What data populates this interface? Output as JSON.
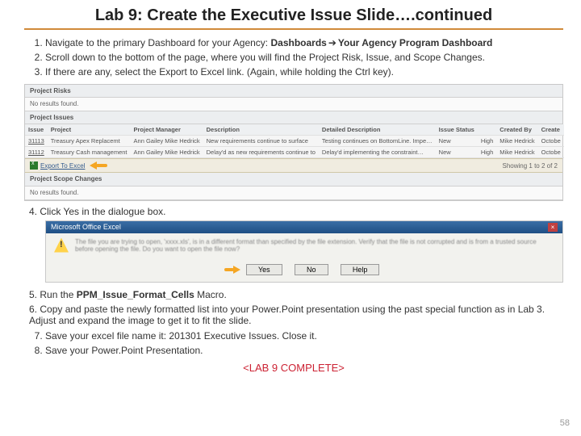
{
  "title": "Lab 9: Create the Executive Issue Slide….continued",
  "steps_top": [
    {
      "pre": "Navigate to the primary Dashboard for your Agency: ",
      "bold": "Dashboards",
      "arrow": "➔",
      "bold2": "Your Agency Program Dashboard"
    },
    {
      "text": "Scroll down to the bottom of the page, where you will find the Project Risk, Issue, and Scope Changes."
    },
    {
      "text": "If there are any, select the Export to Excel link. (Again, while holding the Ctrl key)."
    }
  ],
  "dashboard": {
    "sections": {
      "risks_title": "Project Risks",
      "risks_empty": "No results found.",
      "issues_title": "Project Issues",
      "scope_title": "Project Scope Changes",
      "scope_empty": "No results found."
    },
    "issue_columns": [
      "Issue",
      "Project",
      "Project Manager",
      "Description",
      "Detailed Description",
      "Issue Status",
      "",
      "Created By",
      "Create"
    ],
    "issue_rows": [
      {
        "c": [
          "31113",
          "Treasury Apex Replacemt",
          "Ann Gailey Mike Hedrick",
          "New requirements continue to surface",
          "Testing continues on BottomLine. Impe…",
          "New",
          "High",
          "Mike Hedrick",
          "Octobe"
        ]
      },
      {
        "c": [
          "31112",
          "Treasury Cash management",
          "Ann Gailey Mike Hedrick",
          "Delay'd as new requirements continue to",
          "Delay'd implementing the constraint…",
          "New",
          "High",
          "Mike Hedrick",
          "Octobe"
        ]
      }
    ],
    "export_label": "Export To Excel",
    "showing": "Showing 1 to 2 of 2"
  },
  "step4": "4. Click Yes in the dialogue box.",
  "dialog": {
    "title": "Microsoft Office Excel",
    "body": "The file you are trying to open, 'xxxx.xls', is in a different format than specified by the file extension. Verify that the file is not corrupted and is from a trusted source before opening the file. Do you want to open the file now?",
    "buttons": [
      "Yes",
      "No",
      "Help"
    ]
  },
  "steps_bottom": [
    {
      "n": "5.",
      "pre": "Run the ",
      "bold": "PPM_Issue_Format_Cells",
      "post": " Macro."
    },
    {
      "n": "6.",
      "text": "Copy and paste the newly formatted list into your Power.Point presentation using the past special function as in Lab 3. Adjust and expand the image to get it to fit the slide."
    },
    {
      "n": "7.",
      "text": "Save your excel file name it:  201301 Executive Issues.  Close it."
    },
    {
      "n": "8.",
      "text": "Save your Power.Point Presentation."
    }
  ],
  "complete": "<LAB 9 COMPLETE>",
  "page": "58"
}
